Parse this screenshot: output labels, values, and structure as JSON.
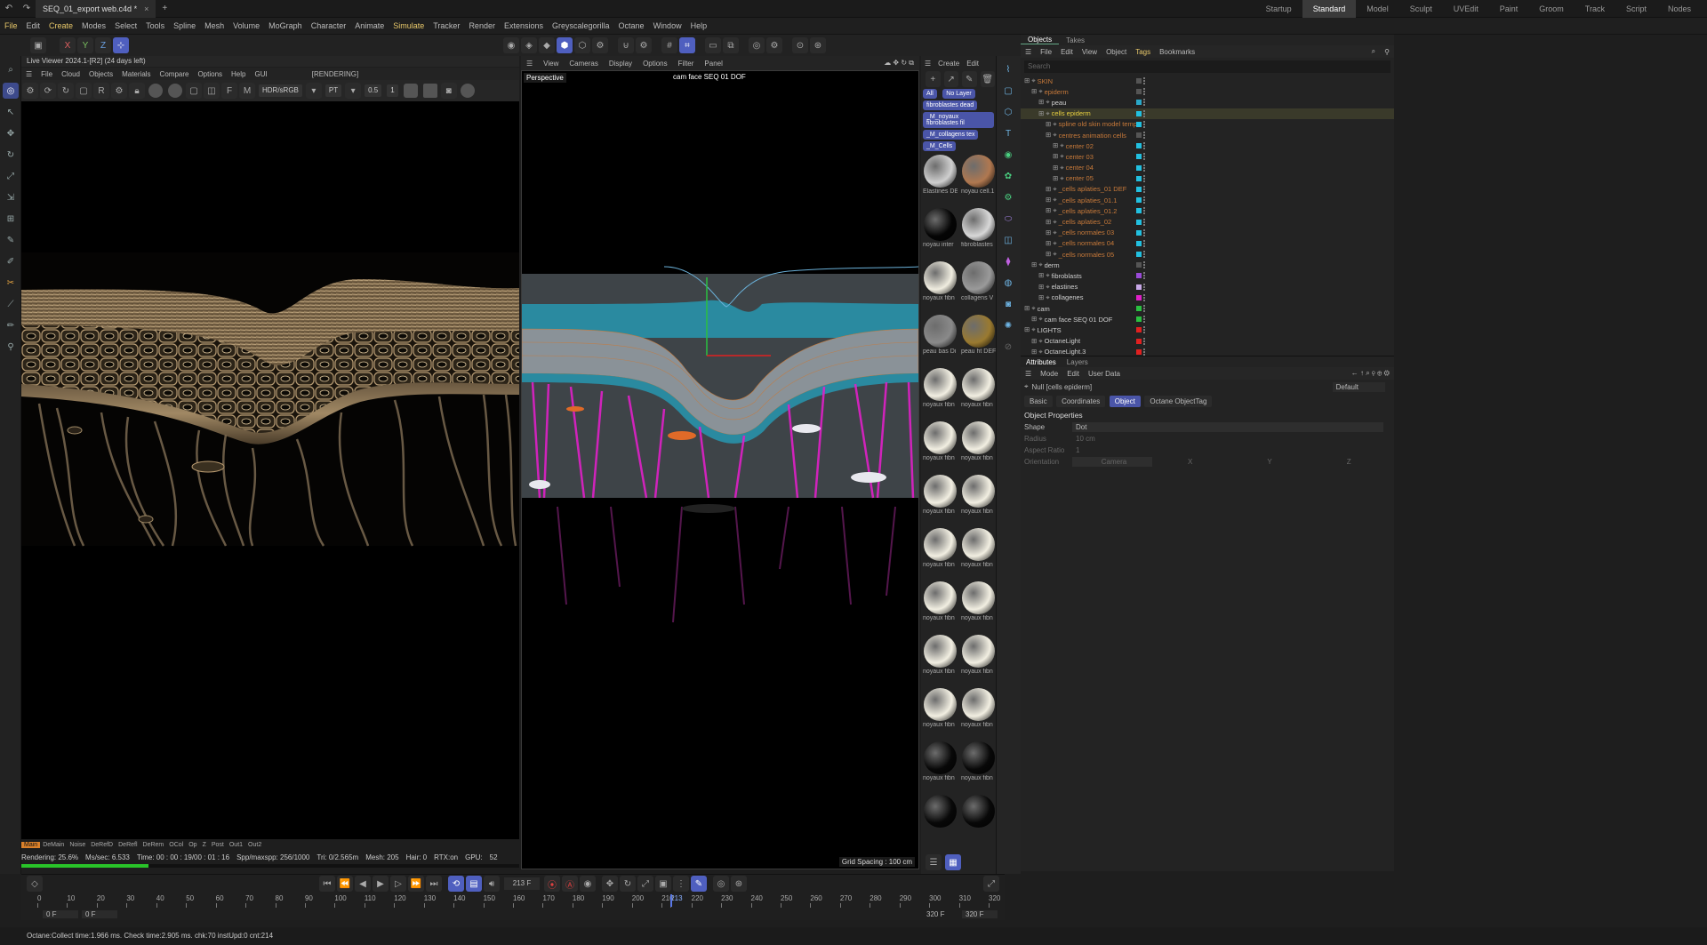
{
  "titlebar": {
    "file_tab": "SEQ_01_export web.c4d *",
    "close_glyph": "×",
    "new_glyph": "+"
  },
  "layouts": [
    "Startup",
    "Standard",
    "Model",
    "Sculpt",
    "UVEdit",
    "Paint",
    "Groom",
    "Track",
    "Script",
    "Nodes"
  ],
  "menu": [
    "File",
    "Edit",
    "Create",
    "Modes",
    "Select",
    "Tools",
    "Spline",
    "Mesh",
    "Volume",
    "MoGraph",
    "Character",
    "Animate",
    "Simulate",
    "Tracker",
    "Render",
    "Extensions",
    "Greyscalegorilla",
    "Octane",
    "Window",
    "Help"
  ],
  "axis_buttons": [
    "X",
    "Y",
    "Z"
  ],
  "live_viewer": {
    "title": "Live Viewer 2024.1-[R2] (24 days left)",
    "menu": [
      "File",
      "Cloud",
      "Objects",
      "Materials",
      "Compare",
      "Options",
      "Help",
      "GUI"
    ],
    "state": "[RENDERING]",
    "colorspace": "HDR/sRGB",
    "kernel": "PT",
    "value1": "0.5",
    "value2": "1",
    "passes": [
      "Main",
      "DeMain",
      "Noise",
      "DeRefD",
      "DeRefl",
      "DeRem",
      "OCol",
      "Op",
      "Z",
      "Post",
      "Out1",
      "Out2"
    ],
    "status": {
      "rendering": "Rendering: 25.6%",
      "ms": "Ms/sec: 6.533",
      "time": "Time: 00 : 00 : 19/00 : 01 : 16",
      "spp": "Spp/maxspp: 256/1000",
      "tri": "Tri: 0/2.565m",
      "mesh": "Mesh: 205",
      "hair": "Hair: 0",
      "rtx": "RTX:on",
      "gpu": "GPU:",
      "gpu_val": "52"
    },
    "progress": 25.6
  },
  "viewport": {
    "menu": [
      "View",
      "Cameras",
      "Display",
      "Options",
      "Filter",
      "Panel"
    ],
    "label": "Perspective",
    "camera": "cam face SEQ 01 DOF",
    "grid": "Grid Spacing : 100 cm"
  },
  "materials": {
    "menu": [
      "Create",
      "Edit"
    ],
    "filters": [
      "All",
      "No Layer"
    ],
    "tags": [
      "fibroblastes dead",
      "_M_noyaux fibroblastes fil",
      "_M_collagens tex",
      "_M_Cells"
    ],
    "items": [
      {
        "name": "Elastines DE",
        "color": "#cfcfcf"
      },
      {
        "name": "noyau cell.1",
        "color": "#b07850"
      },
      {
        "name": "noyau inter",
        "color": "#050505"
      },
      {
        "name": "fibroblastes",
        "color": "#d8d8d8"
      },
      {
        "name": "noyaux fibn",
        "color": "#f0ede0"
      },
      {
        "name": "collagens V",
        "color": "#9a9a9a"
      },
      {
        "name": "peau bas Di",
        "color": "#8a8a8a"
      },
      {
        "name": "peau ht DEF",
        "color": "#9a7a30"
      },
      {
        "name": "noyaux fibn",
        "color": "#f2efe2"
      },
      {
        "name": "noyaux fibn",
        "color": "#f2efe2"
      },
      {
        "name": "noyaux fibn",
        "color": "#f2efe2"
      },
      {
        "name": "noyaux fibn",
        "color": "#f2efe2"
      },
      {
        "name": "noyaux fibn",
        "color": "#f2efe2"
      },
      {
        "name": "noyaux fibn",
        "color": "#f2efe2"
      },
      {
        "name": "noyaux fibn",
        "color": "#f2efe2"
      },
      {
        "name": "noyaux fibn",
        "color": "#f2efe2"
      },
      {
        "name": "noyaux fibn",
        "color": "#f2efe2"
      },
      {
        "name": "noyaux fibn",
        "color": "#f2efe2"
      },
      {
        "name": "noyaux fibn",
        "color": "#f2efe2"
      },
      {
        "name": "noyaux fibn",
        "color": "#f2efe2"
      },
      {
        "name": "noyaux fibn",
        "color": "#f2efe2"
      },
      {
        "name": "noyaux fibn",
        "color": "#f2efe2"
      },
      {
        "name": "noyaux fibn",
        "color": "#080808"
      },
      {
        "name": "noyaux fibn",
        "color": "#080808"
      },
      {
        "name": "",
        "color": "#080808"
      },
      {
        "name": "",
        "color": "#080808"
      }
    ]
  },
  "objects": {
    "tabs": [
      "Objects",
      "Takes"
    ],
    "menu": [
      "File",
      "Edit",
      "View",
      "Object",
      "Tags",
      "Bookmarks"
    ],
    "search_placeholder": "Search",
    "tree": [
      {
        "label": "SKIN",
        "color": "#c87a3a",
        "swatch": ""
      },
      {
        "label": "epiderm",
        "color": "#c87a3a",
        "swatch": ""
      },
      {
        "label": "peau",
        "color": "#cfcfcf",
        "swatch": "#2aa8c8"
      },
      {
        "label": "cells epiderm",
        "color": "#e8d040",
        "swatch": "#22c0e0"
      },
      {
        "label": "spline old skin model temp",
        "color": "#c87a3a",
        "swatch": "#22c0e0"
      },
      {
        "label": "centres animation cells",
        "color": "#c87a3a",
        "swatch": ""
      },
      {
        "label": "center 02",
        "color": "#c87a3a",
        "swatch": "#22c0e0"
      },
      {
        "label": "center 03",
        "color": "#c87a3a",
        "swatch": "#22c0e0"
      },
      {
        "label": "center 04",
        "color": "#c87a3a",
        "swatch": "#22c0e0"
      },
      {
        "label": "center 05",
        "color": "#c87a3a",
        "swatch": "#22c0e0"
      },
      {
        "label": "_cells aplaties_01 DEF",
        "color": "#c87a3a",
        "swatch": "#22c0e0"
      },
      {
        "label": "_cells aplaties_01.1",
        "color": "#c87a3a",
        "swatch": "#22c0e0"
      },
      {
        "label": "_cells aplaties_01.2",
        "color": "#c87a3a",
        "swatch": "#22c0e0"
      },
      {
        "label": "_cells aplaties_02",
        "color": "#c87a3a",
        "swatch": "#22c0e0"
      },
      {
        "label": "_cells normales 03",
        "color": "#c87a3a",
        "swatch": "#22c0e0"
      },
      {
        "label": "_cells normales 04",
        "color": "#c87a3a",
        "swatch": "#22c0e0"
      },
      {
        "label": "_cells normales 05",
        "color": "#c87a3a",
        "swatch": "#22c0e0"
      },
      {
        "label": "derm",
        "color": "#cfcfcf",
        "swatch": ""
      },
      {
        "label": "fibroblasts",
        "color": "#cfcfcf",
        "swatch": "#9a4ad8"
      },
      {
        "label": "elastines",
        "color": "#cfcfcf",
        "swatch": "#c8a8e8"
      },
      {
        "label": "collagenes",
        "color": "#cfcfcf",
        "swatch": "#e020c8"
      },
      {
        "label": "cam",
        "color": "#cfcfcf",
        "swatch": "#2ac040"
      },
      {
        "label": "cam face SEQ 01 DOF",
        "color": "#cfcfcf",
        "swatch": "#2ac040"
      },
      {
        "label": "LIGHTS",
        "color": "#cfcfcf",
        "swatch": "#e02020"
      },
      {
        "label": "OctaneLight",
        "color": "#cfcfcf",
        "swatch": "#e02020"
      },
      {
        "label": "OctaneLight.3",
        "color": "#cfcfcf",
        "swatch": "#e02020"
      }
    ]
  },
  "attributes": {
    "tabs": [
      "Attributes",
      "Layers"
    ],
    "menu": [
      "Mode",
      "Edit",
      "User Data"
    ],
    "object_name": "Null [cells epiderm]",
    "preset": "Default",
    "subtabs": [
      "Basic",
      "Coordinates",
      "Object",
      "Octane ObjectTag"
    ],
    "section": "Object Properties",
    "props": [
      {
        "label": "Shape",
        "value": "Dot"
      },
      {
        "label": "Radius",
        "value": "10 cm"
      },
      {
        "label": "Aspect Ratio",
        "value": "1"
      },
      {
        "label": "Orientation",
        "value": "Camera"
      }
    ],
    "orient_axes": [
      "X",
      "Y",
      "Z"
    ]
  },
  "timeline": {
    "current_frame": "213 F",
    "start": "0 F",
    "start2": "0 F",
    "end": "320 F",
    "end2": "320 F",
    "ticks": [
      "0",
      "10",
      "20",
      "30",
      "40",
      "50",
      "60",
      "70",
      "80",
      "90",
      "100",
      "110",
      "120",
      "130",
      "140",
      "150",
      "160",
      "170",
      "180",
      "190",
      "200",
      "210",
      "213",
      "220",
      "230",
      "240",
      "250",
      "260",
      "270",
      "280",
      "290",
      "300",
      "310",
      "320"
    ]
  },
  "status": "Octane:Collect time:1.966 ms.  Check time:2.905 ms.  chk:70  instUpd:0  cnt:214"
}
